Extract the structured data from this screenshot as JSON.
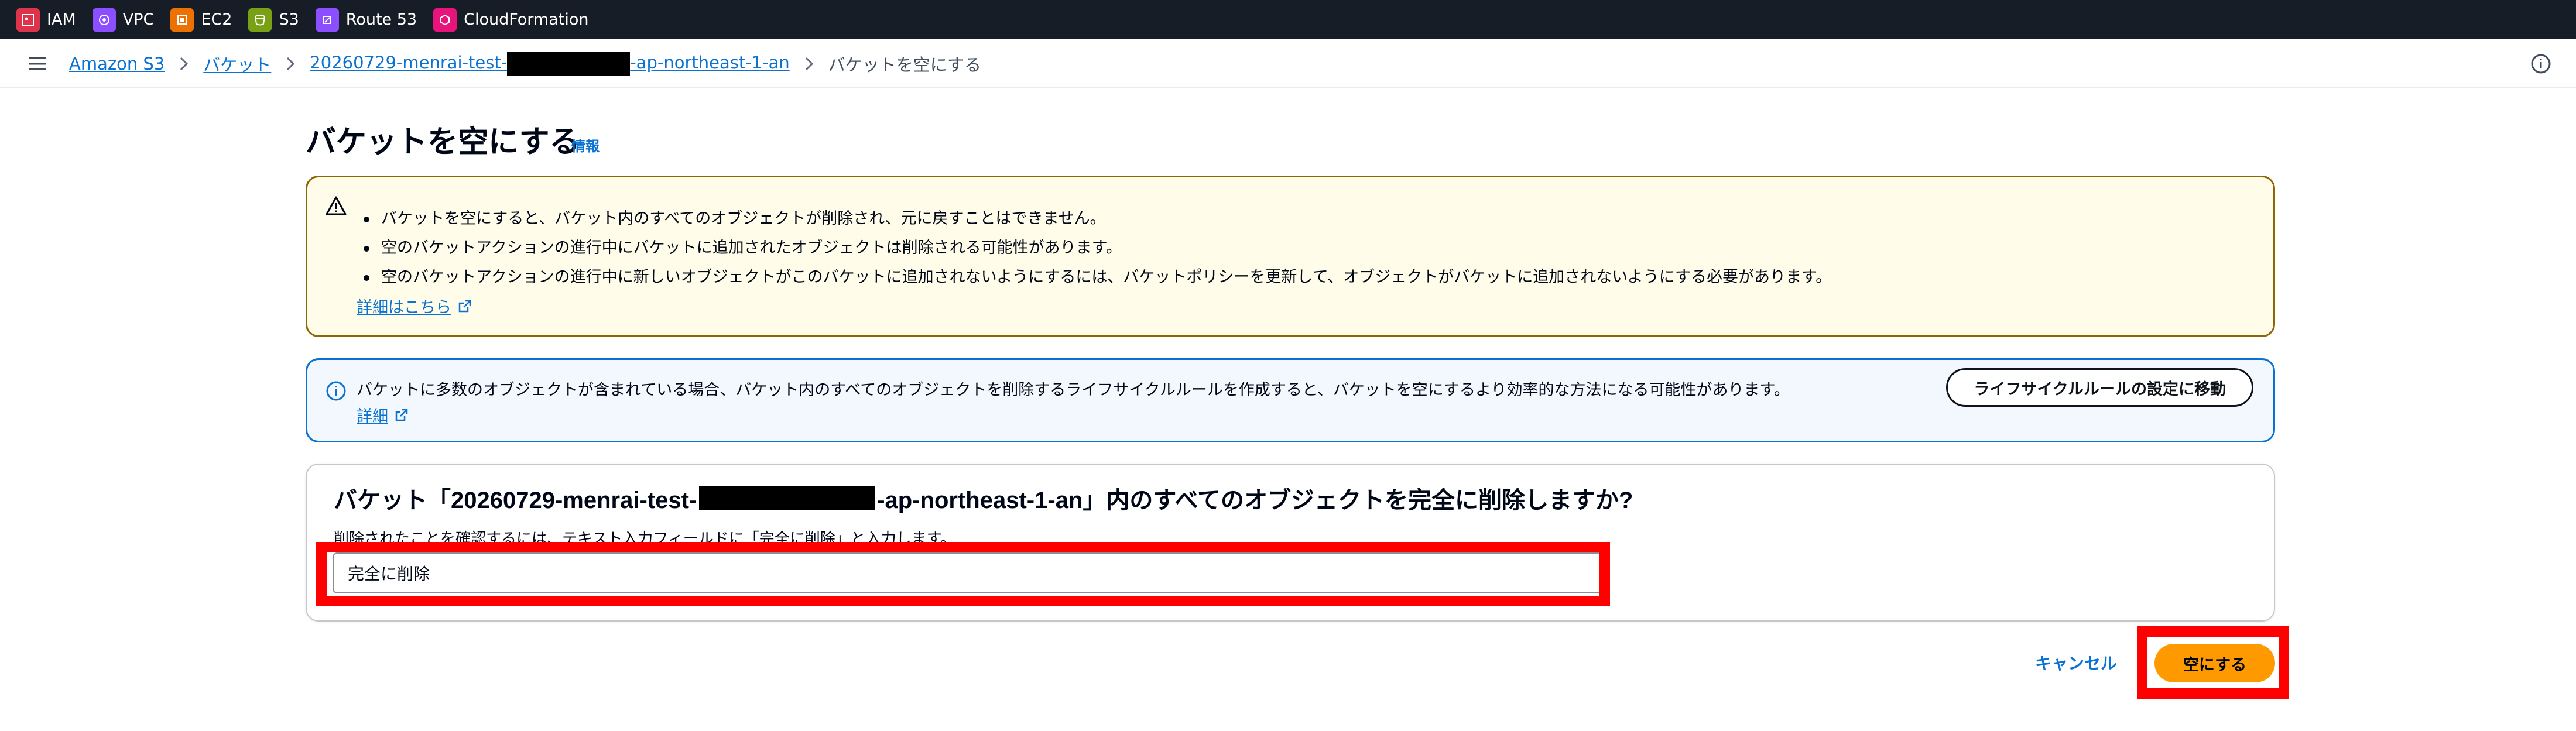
{
  "topbar": {
    "services": [
      {
        "label": "IAM",
        "icon": "iam-icon",
        "color": "#dd344c"
      },
      {
        "label": "VPC",
        "icon": "vpc-icon",
        "color": "#8c4fff"
      },
      {
        "label": "EC2",
        "icon": "ec2-icon",
        "color": "#ed7100"
      },
      {
        "label": "S3",
        "icon": "s3-icon",
        "color": "#7aa116"
      },
      {
        "label": "Route 53",
        "icon": "route53-icon",
        "color": "#8c4fff"
      },
      {
        "label": "CloudFormation",
        "icon": "cloudformation-icon",
        "color": "#e7157b"
      }
    ]
  },
  "breadcrumb": {
    "items": [
      "Amazon S3",
      "バケット"
    ],
    "bucket_prefix": "20260729-menrai-test-",
    "bucket_suffix": "-ap-northeast-1-an",
    "current": "バケットを空にする"
  },
  "page": {
    "title": "バケットを空にする",
    "info_link": "情報"
  },
  "warning": {
    "bullets": [
      "バケットを空にすると、バケット内のすべてのオブジェクトが削除され、元に戻すことはできません。",
      "空のバケットアクションの進行中にバケットに追加されたオブジェクトは削除される可能性があります。",
      "空のバケットアクションの進行中に新しいオブジェクトがこのバケットに追加されないようにするには、バケットポリシーを更新して、オブジェクトがバケットに追加されないようにする必要があります。"
    ],
    "link": "詳細はこちら"
  },
  "info_alert": {
    "text": "バケットに多数のオブジェクトが含まれている場合、バケット内のすべてのオブジェクトを削除するライフサイクルルールを作成すると、バケットを空にするより効率的な方法になる可能性があります。",
    "link": "詳細",
    "button": "ライフサイクルルールの設定に移動"
  },
  "confirm": {
    "question_prefix": "バケット「20260729-menrai-test-",
    "question_suffix": "-ap-northeast-1-an」内のすべてのオブジェクトを完全に削除しますか?",
    "hint": "削除されたことを確認するには、テキスト入力フィールドに「完全に削除」と入力します。",
    "input_value": "完全に削除"
  },
  "actions": {
    "cancel": "キャンセル",
    "empty": "空にする"
  },
  "colors": {
    "accent": "#ff9900",
    "link": "#0972d3",
    "warning_border": "#8d6605",
    "highlight": "#ff0000"
  }
}
